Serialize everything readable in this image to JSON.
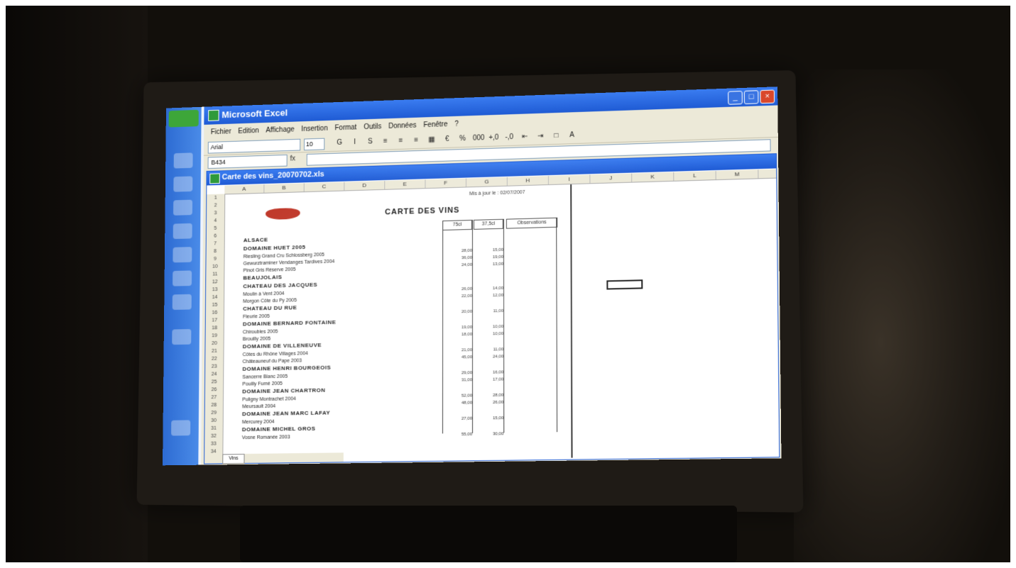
{
  "app": {
    "title": "Microsoft Excel",
    "window_buttons": [
      "_",
      "□",
      "×"
    ]
  },
  "menu": [
    "Fichier",
    "Edition",
    "Affichage",
    "Insertion",
    "Format",
    "Outils",
    "Données",
    "Fenêtre",
    "?"
  ],
  "toolbar": {
    "font": "Arial",
    "size": "10",
    "buttons": [
      "G",
      "I",
      "S",
      "≡",
      "≡",
      "≡",
      "▦",
      "€",
      "%",
      "000",
      "+,0",
      "-,0",
      "⇤",
      "⇥",
      "□",
      "A"
    ]
  },
  "formula_bar": {
    "name_box": "B434",
    "fx": "fx",
    "formula": ""
  },
  "workbook": {
    "title": "Carte des vins_20070702.xls",
    "sheet_tab": "Vins"
  },
  "columns": [
    "A",
    "B",
    "C",
    "D",
    "E",
    "F",
    "G",
    "H",
    "I",
    "J",
    "K",
    "L",
    "M"
  ],
  "rows": [
    "1",
    "2",
    "3",
    "4",
    "5",
    "6",
    "7",
    "8",
    "9",
    "10",
    "11",
    "12",
    "13",
    "14",
    "15",
    "16",
    "17",
    "18",
    "19",
    "20",
    "21",
    "22",
    "23",
    "24",
    "25",
    "26",
    "27",
    "28",
    "29",
    "30",
    "31",
    "32",
    "33",
    "34"
  ],
  "document": {
    "date_line": "Mis à jour le : 02/07/2007",
    "title": "CARTE DES VINS",
    "headers": [
      "75cl",
      "37,5cl",
      "Observations"
    ],
    "entries": [
      {
        "text": "ALSACE",
        "cat": true
      },
      {
        "text": "DOMAINE HUET 2005",
        "cat": true
      },
      {
        "text": "Riesling Grand Cru Schlossberg 2005",
        "cat": false,
        "p1": "28,00",
        "p2": "15,00"
      },
      {
        "text": "Gewurztraminer Vendanges Tardives 2004",
        "cat": false,
        "p1": "36,00",
        "p2": "19,00"
      },
      {
        "text": "Pinot Gris Réserve 2005",
        "cat": false,
        "p1": "24,00",
        "p2": "13,00"
      },
      {
        "text": "BEAUJOLAIS",
        "cat": true
      },
      {
        "text": "CHATEAU DES JACQUES",
        "cat": true
      },
      {
        "text": "Moulin à Vent 2004",
        "cat": false,
        "p1": "26,00",
        "p2": "14,00"
      },
      {
        "text": "Morgon Côte du Py 2005",
        "cat": false,
        "p1": "22,00",
        "p2": "12,00"
      },
      {
        "text": "CHATEAU DU RUE",
        "cat": true
      },
      {
        "text": "Fleurie 2005",
        "cat": false,
        "p1": "20,00",
        "p2": "11,00"
      },
      {
        "text": "DOMAINE BERNARD FONTAINE",
        "cat": true
      },
      {
        "text": "Chiroubles 2005",
        "cat": false,
        "p1": "19,00",
        "p2": "10,00"
      },
      {
        "text": "Brouilly 2005",
        "cat": false,
        "p1": "18,00",
        "p2": "10,00"
      },
      {
        "text": "DOMAINE DE VILLENEUVE",
        "cat": true
      },
      {
        "text": "Côtes du Rhône Villages 2004",
        "cat": false,
        "p1": "21,00",
        "p2": "11,00"
      },
      {
        "text": "Châteauneuf du Pape 2003",
        "cat": false,
        "p1": "45,00",
        "p2": "24,00"
      },
      {
        "text": "DOMAINE HENRI BOURGEOIS",
        "cat": true
      },
      {
        "text": "Sancerre Blanc 2005",
        "cat": false,
        "p1": "29,00",
        "p2": "16,00"
      },
      {
        "text": "Pouilly Fumé 2005",
        "cat": false,
        "p1": "31,00",
        "p2": "17,00"
      },
      {
        "text": "DOMAINE JEAN CHARTRON",
        "cat": true
      },
      {
        "text": "Puligny Montrachet 2004",
        "cat": false,
        "p1": "52,00",
        "p2": "28,00"
      },
      {
        "text": "Meursault 2004",
        "cat": false,
        "p1": "48,00",
        "p2": "26,00"
      },
      {
        "text": "DOMAINE JEAN MARC LAFAY",
        "cat": true
      },
      {
        "text": "Mercurey 2004",
        "cat": false,
        "p1": "27,00",
        "p2": "15,00"
      },
      {
        "text": "DOMAINE MICHEL GROS",
        "cat": true
      },
      {
        "text": "Vosne Romanée 2003",
        "cat": false,
        "p1": "55,00",
        "p2": "30,00"
      }
    ]
  }
}
